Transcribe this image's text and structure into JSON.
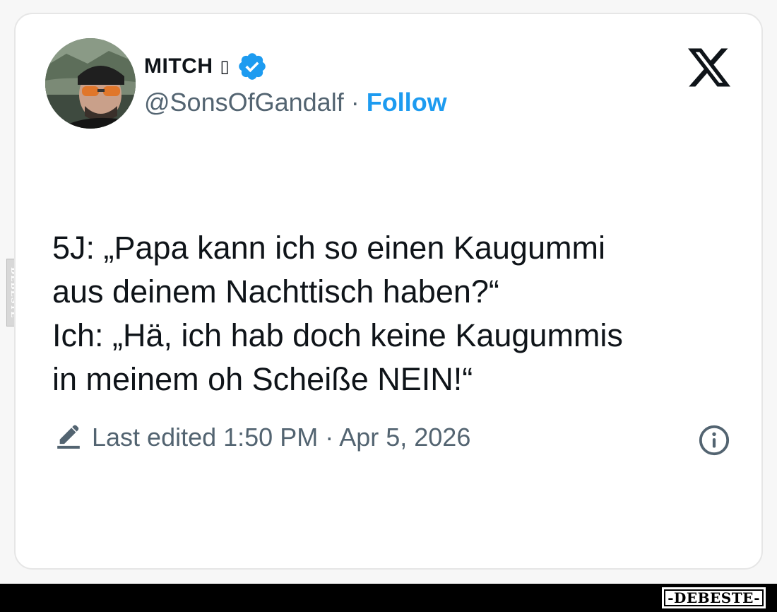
{
  "author": {
    "name": "MITCH",
    "name_emoji": "▯",
    "handle": "@SonsOfGandalf",
    "separator": "·",
    "follow_label": "Follow"
  },
  "tweet": {
    "text": "5J: „Papa kann ich so einen Kaugummi\naus deinem Nachttisch haben?“\nIch: „Hä, ich hab doch keine Kaugummis\nin meinem oh Scheiße NEIN!“"
  },
  "meta": {
    "edited_label": "Last edited 1:50 PM · Apr 5, 2026"
  },
  "icons": {
    "brand": "x-logo-icon",
    "verified": "verified-badge-icon",
    "edit": "pencil-icon",
    "info": "info-icon"
  },
  "watermark": {
    "side_text": "DEBESTE",
    "bottom_text": "-DEBESTE-"
  },
  "colors": {
    "accent": "#1d9bf0",
    "text_primary": "#0f1419",
    "text_secondary": "#536471"
  }
}
